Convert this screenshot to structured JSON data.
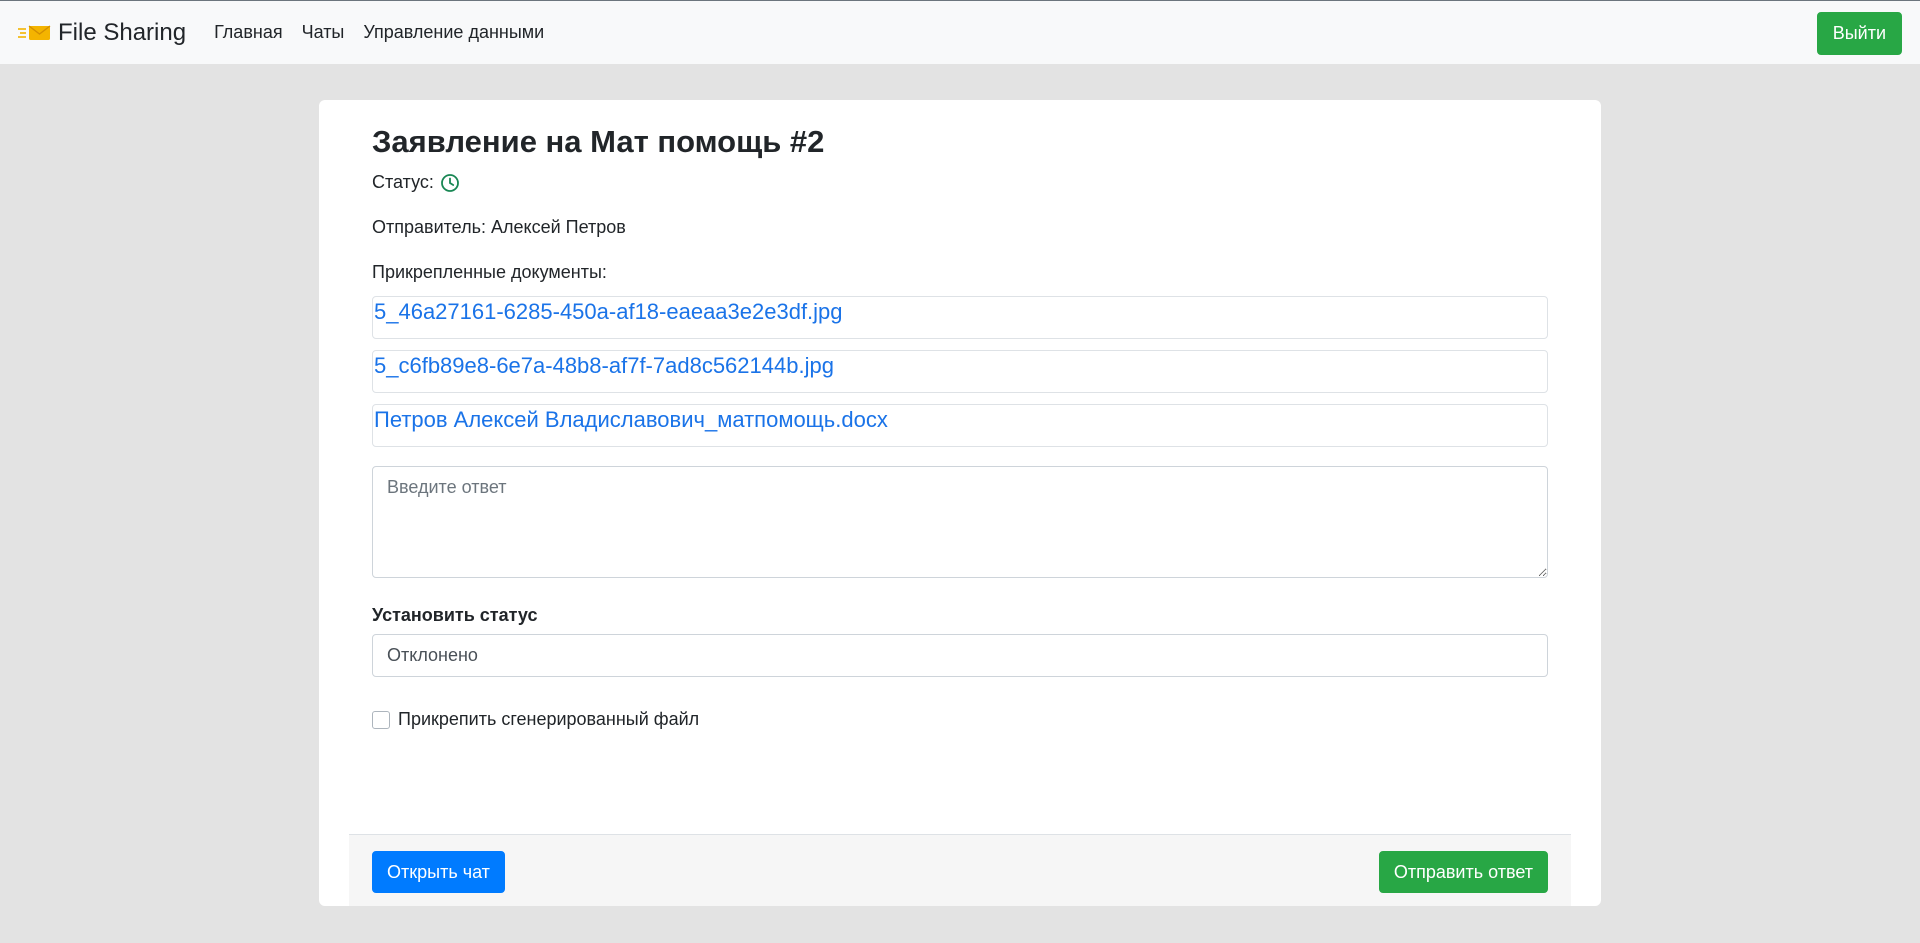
{
  "navbar": {
    "brand": "File Sharing",
    "links": [
      "Главная",
      "Чаты",
      "Управление данными"
    ],
    "logout": "Выйти"
  },
  "request": {
    "title": "Заявление на Мат помощь #2",
    "status_label": "Статус:",
    "status_icon": "clock-icon",
    "sender": "Отправитель: Алексей Петров",
    "docs_label": "Прикрепленные документы:",
    "documents": [
      "5_46a27161-6285-450a-af18-eaeaa3e2e3df.jpg",
      "5_c6fb89e8-6e7a-48b8-af7f-7ad8c562144b.jpg",
      "Петров Алексей Владиславович_матпомощь.docx"
    ]
  },
  "form": {
    "reply_placeholder": "Введите ответ",
    "set_status_label": "Установить статус",
    "status_value": "Отклонено",
    "attach_generated_label": "Прикрепить сгенерированный файл",
    "attach_generated_checked": false
  },
  "footer": {
    "open_chat": "Открыть чат",
    "send_reply": "Отправить ответ"
  },
  "colors": {
    "primary": "#007bff",
    "success": "#28a745",
    "link": "#1a73e8",
    "status_icon": "#198754"
  }
}
